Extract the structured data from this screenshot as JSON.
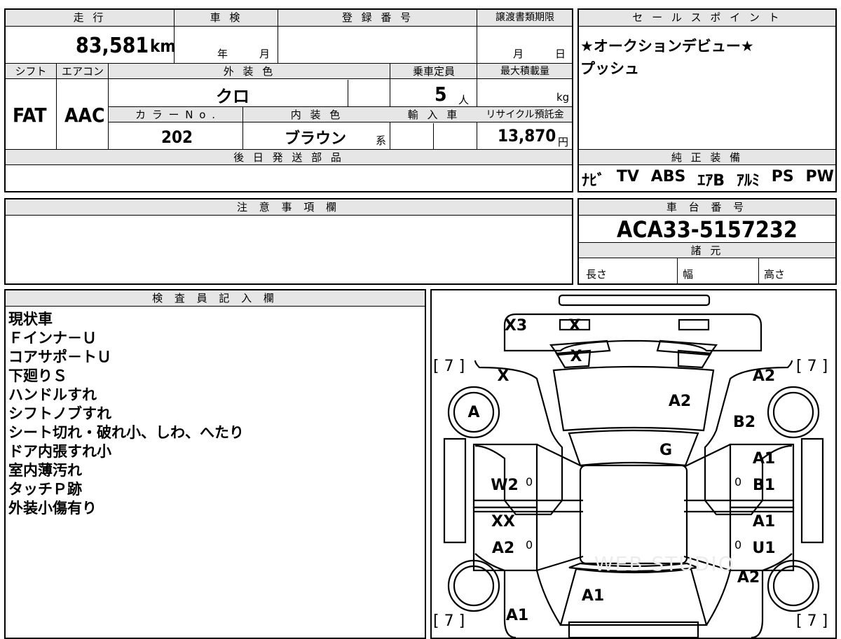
{
  "top": {
    "mileage_label": "走 行",
    "mileage_value": "83,581",
    "mileage_unit": "km",
    "inspection_label": "車 検",
    "year_unit": "年",
    "month_unit": "月",
    "registration_label": "登 録 番 号",
    "transfer_label": "譲渡書類期限",
    "month_unit2": "月",
    "day_unit": "日",
    "shift_label": "シフト",
    "ac_label": "エアコン",
    "exterior_color_label": "外 装 色",
    "capacity_label": "乗車定員",
    "max_load_label": "最大積載量",
    "shift_value": "FAT",
    "ac_value": "AAC",
    "exterior_color_value": "クロ",
    "capacity_value": "5",
    "capacity_unit": "人",
    "load_unit": "kg",
    "color_no_label": "カ ラ ー N o .",
    "interior_color_label": "内 装 色",
    "import_label": "輸 入 車",
    "recycle_label": "リサイクル預託金",
    "color_no_value": "202",
    "interior_color_value": "ブラウン",
    "interior_suffix": "系",
    "recycle_value": "13,870",
    "recycle_unit": "円",
    "later_parts_label": "後 日 発 送 部 品"
  },
  "sales": {
    "label": "セ ー ル ス ポ イ ン ト",
    "line1": "★オークションデビュー★",
    "line2": "プッシュ"
  },
  "equipment": {
    "label": "純 正 装 備",
    "items": [
      "ﾅﾋﾞ",
      "TV",
      "ABS",
      "ｴｱB",
      "ｱﾙﾐ",
      "PS",
      "PW"
    ]
  },
  "notes": {
    "label": "注 意 事 項 欄"
  },
  "chassis": {
    "label": "車 台 番 号",
    "value": "ACA33-5157232",
    "specs_label": "諸 元",
    "length_label": "長さ",
    "width_label": "幅",
    "height_label": "高さ"
  },
  "inspector": {
    "label": "検 査 員 記 入 欄",
    "lines": [
      "現状車",
      "Ｆインナ－Ｕ",
      "コアサポ－トＵ",
      "下廻りＳ",
      "ハンドルすれ",
      "シフトノブすれ",
      "シート切れ・破れ小、しわ、へたり",
      "ドア内張すれ小",
      "室内薄汚れ",
      "タッチＰ跡",
      "外装小傷有り"
    ]
  },
  "diagram": {
    "tire_mark": "[ 7 ]",
    "small_zero": "0",
    "watermark": "WEB STUDIO",
    "codes": {
      "front_bumper": "X3",
      "grille": "X",
      "hood_emblem": "X",
      "front_left_fender": "X",
      "front_right_fender": "A2",
      "hood": "A2",
      "front_left_wheel": "A",
      "front_right_area": "B2",
      "windshield": "G",
      "right_front_door_a": "A1",
      "right_front_door_b": "B1",
      "left_front_door": "W2",
      "left_rear_door_a": "XX",
      "left_rear_door_b": "A2",
      "right_rear_door_a": "A1",
      "right_rear_door_b": "U1",
      "right_rear_fender": "A2",
      "trunk": "A1",
      "rear_bumper_left": "A1"
    }
  }
}
